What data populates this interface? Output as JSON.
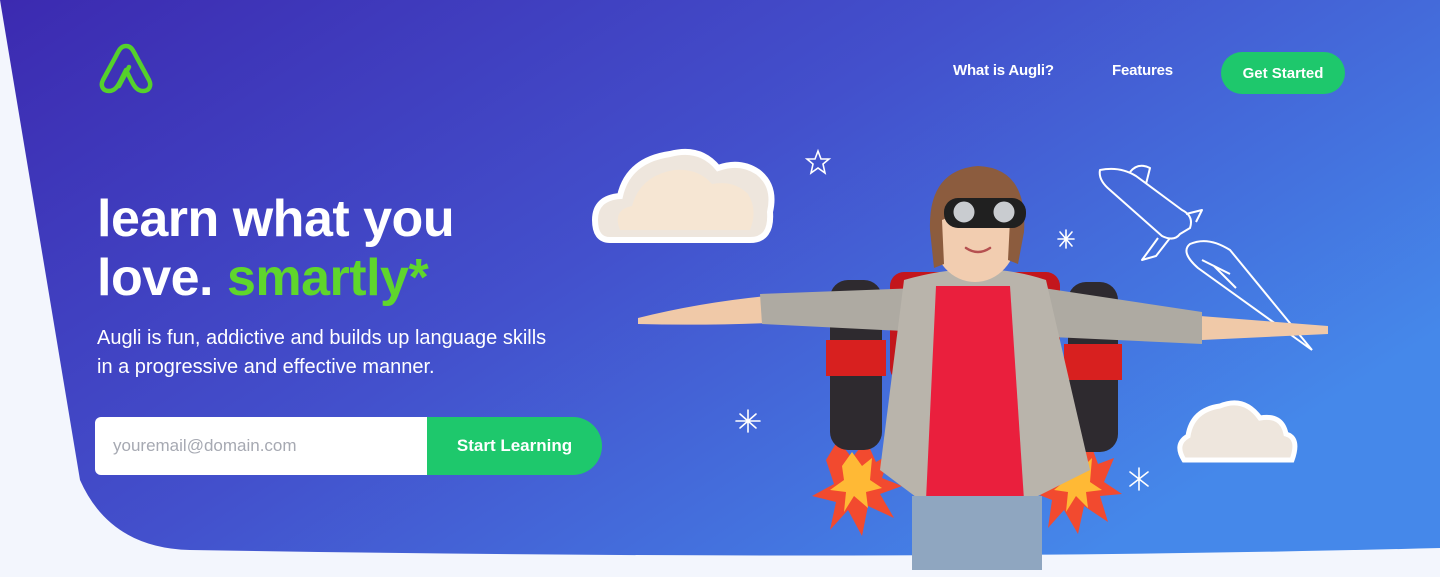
{
  "colors": {
    "gradient_start": "#3f2bb2",
    "gradient_end": "#4485ea",
    "accent_green": "#1ec86c",
    "headline_green": "#5fd62c",
    "page_bg": "#f3f6fd"
  },
  "brand": {
    "logo_icon": "augli-logo-icon"
  },
  "nav": {
    "links": [
      {
        "label": "What is Augli?"
      },
      {
        "label": "Features"
      }
    ],
    "cta_label": "Get Started"
  },
  "hero": {
    "headline_line1": "learn what you",
    "headline_line2_prefix": "love. ",
    "headline_accent": "smartly*",
    "subtitle": "Augli is fun, addictive and builds up language skills in a progressive and effective manner.",
    "email_placeholder": "youremail@domain.com",
    "email_value": "",
    "submit_label": "Start Learning"
  },
  "illustration": {
    "subject": "kid-with-jetpack-photo",
    "decorations": [
      "cloud-icon",
      "cloud-icon",
      "star-icon",
      "sparkle-icon",
      "rocket-icon",
      "comet-icon"
    ]
  }
}
